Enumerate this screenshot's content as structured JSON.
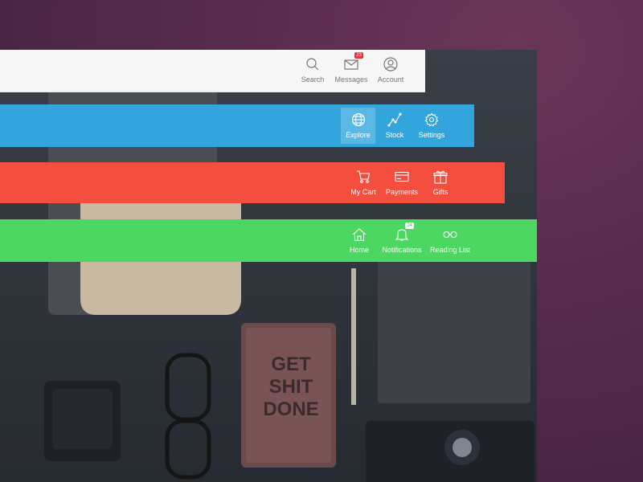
{
  "white_bar": {
    "items": [
      {
        "label": "Search",
        "icon": "search-icon"
      },
      {
        "label": "Messages",
        "icon": "envelope-icon",
        "badge": "23"
      },
      {
        "label": "Account",
        "icon": "user-icon"
      }
    ]
  },
  "blue_bar": {
    "items": [
      {
        "label": "Explore",
        "icon": "globe-icon",
        "active": true
      },
      {
        "label": "Stock",
        "icon": "line-chart-icon"
      },
      {
        "label": "Settings",
        "icon": "gear-icon"
      }
    ]
  },
  "red_bar": {
    "items": [
      {
        "label": "My Cart",
        "icon": "cart-icon"
      },
      {
        "label": "Payments",
        "icon": "credit-card-icon"
      },
      {
        "label": "Gifts",
        "icon": "gift-icon"
      }
    ]
  },
  "green_bar": {
    "items": [
      {
        "label": "Home",
        "icon": "home-icon"
      },
      {
        "label": "Notifications",
        "icon": "bell-icon",
        "badge": "24"
      },
      {
        "label": "Reading List",
        "icon": "glasses-icon"
      }
    ]
  },
  "photo": {
    "notebook_text": [
      "GET",
      "SHIT",
      "DONE"
    ]
  },
  "colors": {
    "white_bar": "#f6f6f6",
    "blue_bar": "#32a6dc",
    "red_bar": "#f44e3e",
    "green_bar": "#4cd662",
    "badge": "#e8363b"
  }
}
